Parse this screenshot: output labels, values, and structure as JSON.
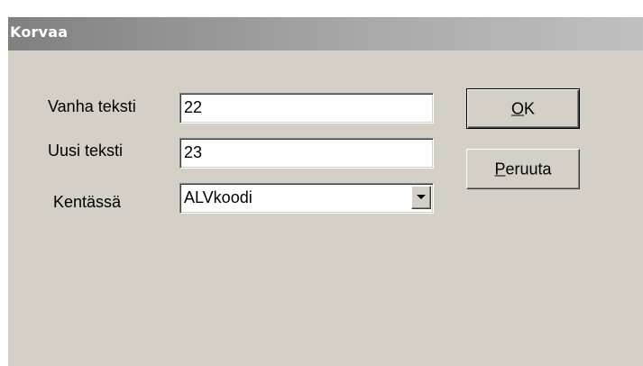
{
  "window": {
    "title": "Korvaa"
  },
  "form": {
    "old_text": {
      "label": "Vanha teksti",
      "value": "22"
    },
    "new_text": {
      "label": "Uusi teksti",
      "value": "23"
    },
    "field": {
      "label": "Kentässä",
      "selected": "ALVkoodi"
    }
  },
  "buttons": {
    "ok": {
      "mnemonic": "O",
      "rest": "K"
    },
    "cancel": {
      "mnemonic": "P",
      "rest": "eruuta"
    }
  },
  "icons": {
    "dropdown": "chevron-down-icon"
  },
  "colors": {
    "dialog_bg": "#d4d0c8",
    "titlebar_start": "#808080",
    "titlebar_end": "#c0c0c0"
  }
}
